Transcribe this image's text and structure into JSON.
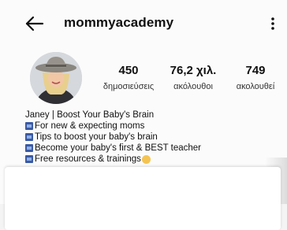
{
  "header": {
    "username": "mommyacademy"
  },
  "stats": {
    "posts": {
      "value": "450",
      "label": "δημοσιεύσεις"
    },
    "followers": {
      "value": "76,2 χιλ.",
      "label": "ακόλουθοι"
    },
    "following": {
      "value": "749",
      "label": "ακολουθεί"
    }
  },
  "bio": {
    "name": "Janey | Boost Your Baby's Brain",
    "lines": [
      "For new & expecting moms",
      "Tips to boost your baby's brain",
      "Become your baby's first & BEST teacher",
      "Free resources & trainings"
    ]
  },
  "icons": {
    "back": "arrow-left-icon",
    "more": "more-vertical-icon",
    "bullet": "blue-square-emoji-icon",
    "emoji": "smile-emoji-icon"
  },
  "colors": {
    "bullet": "#3b5aa3",
    "background": "#fbfbfb"
  }
}
